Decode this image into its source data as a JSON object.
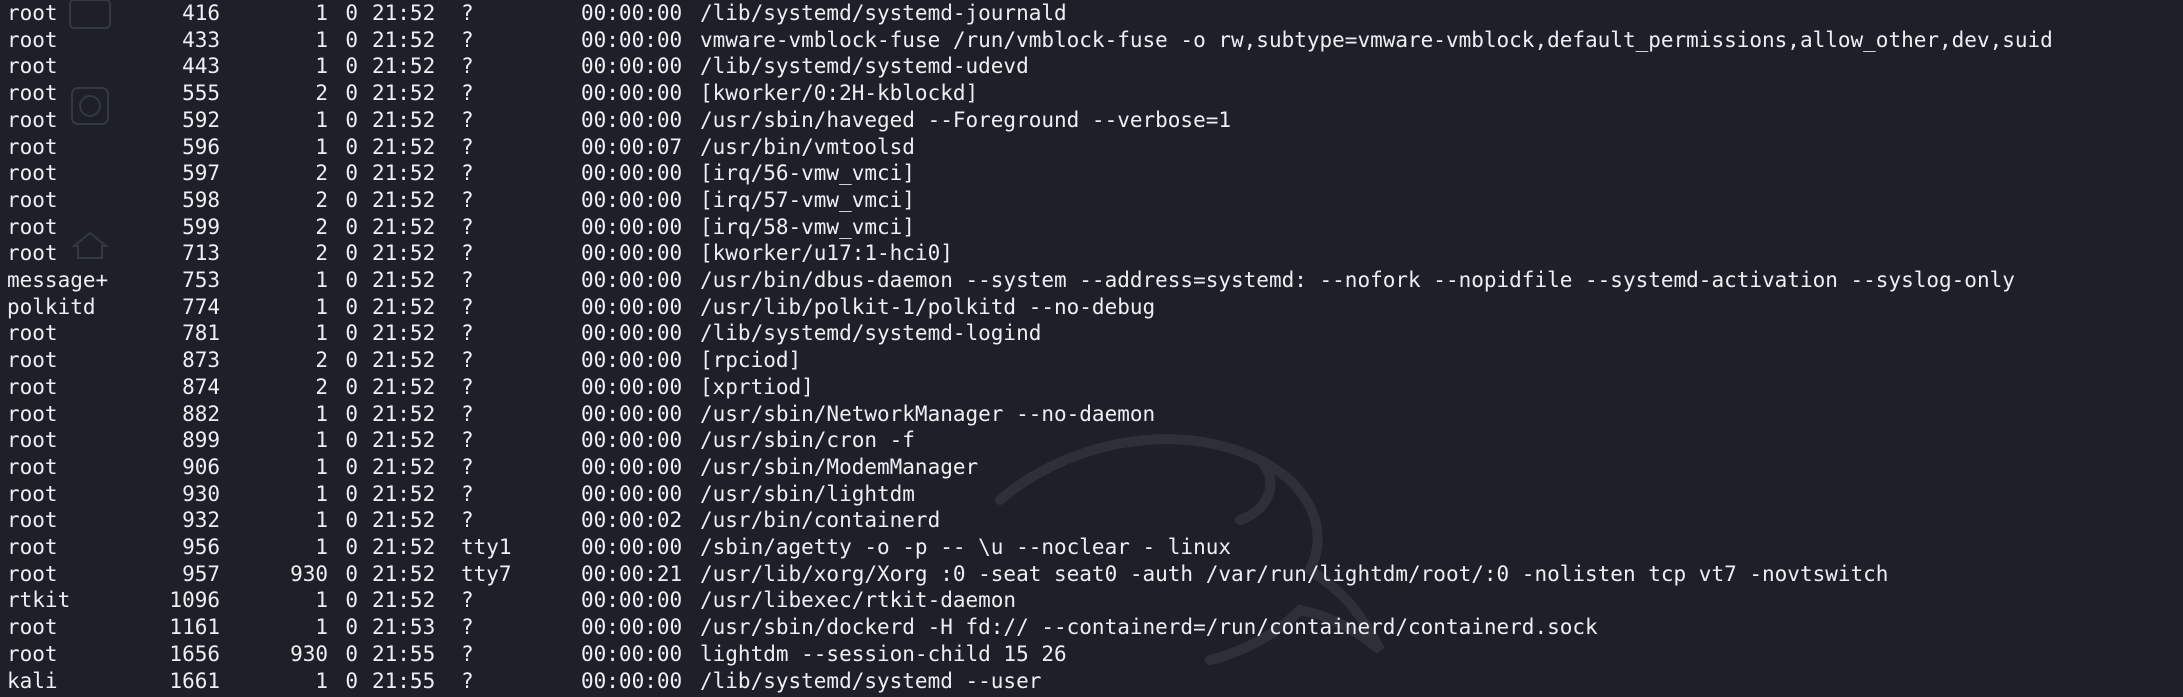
{
  "terminal": {
    "colors": {
      "background": "#1d2027",
      "foreground": "#eceff4"
    },
    "desktop_icon_names": [
      "trash-icon",
      "filesystem-icon",
      "home-icon"
    ],
    "rows": [
      {
        "uid": "root",
        "pid": "416",
        "ppid": "1",
        "c": "0",
        "stime": "21:52",
        "tty": "?",
        "time": "00:00:00",
        "cmd": "/lib/systemd/systemd-journald"
      },
      {
        "uid": "root",
        "pid": "433",
        "ppid": "1",
        "c": "0",
        "stime": "21:52",
        "tty": "?",
        "time": "00:00:00",
        "cmd": "vmware-vmblock-fuse /run/vmblock-fuse -o rw,subtype=vmware-vmblock,default_permissions,allow_other,dev,suid"
      },
      {
        "uid": "root",
        "pid": "443",
        "ppid": "1",
        "c": "0",
        "stime": "21:52",
        "tty": "?",
        "time": "00:00:00",
        "cmd": "/lib/systemd/systemd-udevd"
      },
      {
        "uid": "root",
        "pid": "555",
        "ppid": "2",
        "c": "0",
        "stime": "21:52",
        "tty": "?",
        "time": "00:00:00",
        "cmd": "[kworker/0:2H-kblockd]"
      },
      {
        "uid": "root",
        "pid": "592",
        "ppid": "1",
        "c": "0",
        "stime": "21:52",
        "tty": "?",
        "time": "00:00:00",
        "cmd": "/usr/sbin/haveged --Foreground --verbose=1"
      },
      {
        "uid": "root",
        "pid": "596",
        "ppid": "1",
        "c": "0",
        "stime": "21:52",
        "tty": "?",
        "time": "00:00:07",
        "cmd": "/usr/bin/vmtoolsd"
      },
      {
        "uid": "root",
        "pid": "597",
        "ppid": "2",
        "c": "0",
        "stime": "21:52",
        "tty": "?",
        "time": "00:00:00",
        "cmd": "[irq/56-vmw_vmci]"
      },
      {
        "uid": "root",
        "pid": "598",
        "ppid": "2",
        "c": "0",
        "stime": "21:52",
        "tty": "?",
        "time": "00:00:00",
        "cmd": "[irq/57-vmw_vmci]"
      },
      {
        "uid": "root",
        "pid": "599",
        "ppid": "2",
        "c": "0",
        "stime": "21:52",
        "tty": "?",
        "time": "00:00:00",
        "cmd": "[irq/58-vmw_vmci]"
      },
      {
        "uid": "root",
        "pid": "713",
        "ppid": "2",
        "c": "0",
        "stime": "21:52",
        "tty": "?",
        "time": "00:00:00",
        "cmd": "[kworker/u17:1-hci0]"
      },
      {
        "uid": "message+",
        "pid": "753",
        "ppid": "1",
        "c": "0",
        "stime": "21:52",
        "tty": "?",
        "time": "00:00:00",
        "cmd": "/usr/bin/dbus-daemon --system --address=systemd: --nofork --nopidfile --systemd-activation --syslog-only"
      },
      {
        "uid": "polkitd",
        "pid": "774",
        "ppid": "1",
        "c": "0",
        "stime": "21:52",
        "tty": "?",
        "time": "00:00:00",
        "cmd": "/usr/lib/polkit-1/polkitd --no-debug"
      },
      {
        "uid": "root",
        "pid": "781",
        "ppid": "1",
        "c": "0",
        "stime": "21:52",
        "tty": "?",
        "time": "00:00:00",
        "cmd": "/lib/systemd/systemd-logind"
      },
      {
        "uid": "root",
        "pid": "873",
        "ppid": "2",
        "c": "0",
        "stime": "21:52",
        "tty": "?",
        "time": "00:00:00",
        "cmd": "[rpciod]"
      },
      {
        "uid": "root",
        "pid": "874",
        "ppid": "2",
        "c": "0",
        "stime": "21:52",
        "tty": "?",
        "time": "00:00:00",
        "cmd": "[xprtiod]"
      },
      {
        "uid": "root",
        "pid": "882",
        "ppid": "1",
        "c": "0",
        "stime": "21:52",
        "tty": "?",
        "time": "00:00:00",
        "cmd": "/usr/sbin/NetworkManager --no-daemon"
      },
      {
        "uid": "root",
        "pid": "899",
        "ppid": "1",
        "c": "0",
        "stime": "21:52",
        "tty": "?",
        "time": "00:00:00",
        "cmd": "/usr/sbin/cron -f"
      },
      {
        "uid": "root",
        "pid": "906",
        "ppid": "1",
        "c": "0",
        "stime": "21:52",
        "tty": "?",
        "time": "00:00:00",
        "cmd": "/usr/sbin/ModemManager"
      },
      {
        "uid": "root",
        "pid": "930",
        "ppid": "1",
        "c": "0",
        "stime": "21:52",
        "tty": "?",
        "time": "00:00:00",
        "cmd": "/usr/sbin/lightdm"
      },
      {
        "uid": "root",
        "pid": "932",
        "ppid": "1",
        "c": "0",
        "stime": "21:52",
        "tty": "?",
        "time": "00:00:02",
        "cmd": "/usr/bin/containerd"
      },
      {
        "uid": "root",
        "pid": "956",
        "ppid": "1",
        "c": "0",
        "stime": "21:52",
        "tty": "tty1",
        "time": "00:00:00",
        "cmd": "/sbin/agetty -o -p -- \\u --noclear - linux"
      },
      {
        "uid": "root",
        "pid": "957",
        "ppid": "930",
        "c": "0",
        "stime": "21:52",
        "tty": "tty7",
        "time": "00:00:21",
        "cmd": "/usr/lib/xorg/Xorg :0 -seat seat0 -auth /var/run/lightdm/root/:0 -nolisten tcp vt7 -novtswitch"
      },
      {
        "uid": "rtkit",
        "pid": "1096",
        "ppid": "1",
        "c": "0",
        "stime": "21:52",
        "tty": "?",
        "time": "00:00:00",
        "cmd": "/usr/libexec/rtkit-daemon"
      },
      {
        "uid": "root",
        "pid": "1161",
        "ppid": "1",
        "c": "0",
        "stime": "21:53",
        "tty": "?",
        "time": "00:00:00",
        "cmd": "/usr/sbin/dockerd -H fd:// --containerd=/run/containerd/containerd.sock"
      },
      {
        "uid": "root",
        "pid": "1656",
        "ppid": "930",
        "c": "0",
        "stime": "21:55",
        "tty": "?",
        "time": "00:00:00",
        "cmd": "lightdm --session-child 15 26"
      },
      {
        "uid": "kali",
        "pid": "1661",
        "ppid": "1",
        "c": "0",
        "stime": "21:55",
        "tty": "?",
        "time": "00:00:00",
        "cmd": "/lib/systemd/systemd --user"
      }
    ]
  }
}
